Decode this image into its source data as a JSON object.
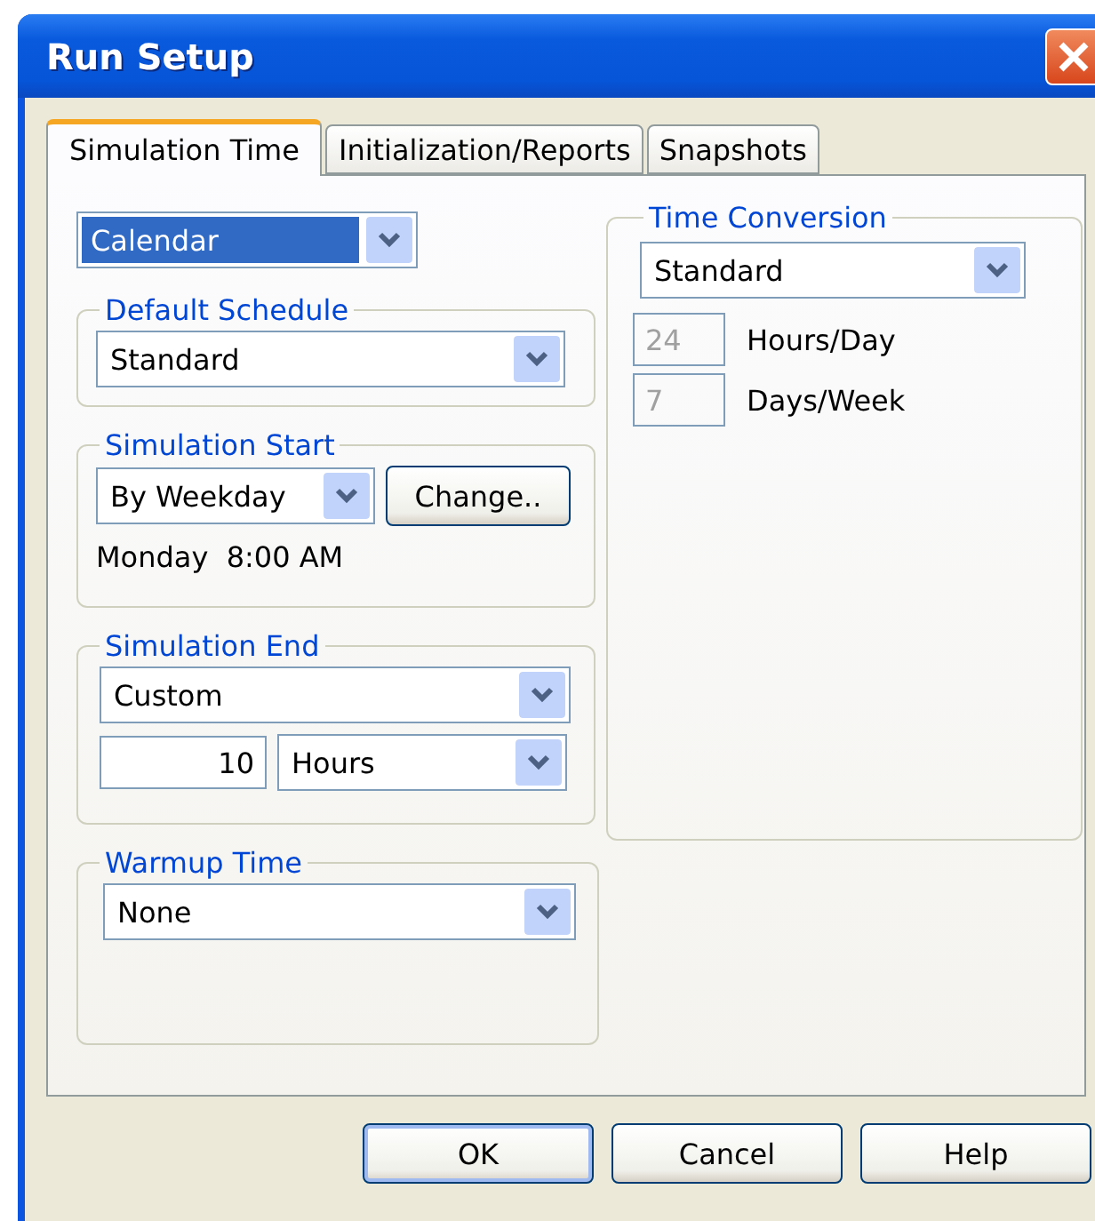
{
  "window": {
    "title": "Run Setup"
  },
  "tabs": [
    {
      "label": "Simulation Time",
      "selected": true
    },
    {
      "label": "Initialization/Reports",
      "selected": false
    },
    {
      "label": "Snapshots",
      "selected": false
    }
  ],
  "mode_select": {
    "value": "Calendar",
    "highlighted": true
  },
  "default_schedule": {
    "title": "Default Schedule",
    "select": "Standard"
  },
  "simulation_start": {
    "title": "Simulation Start",
    "select": "By Weekday",
    "button": "Change..",
    "start_text": "Monday  8:00 AM"
  },
  "simulation_end": {
    "title": "Simulation End",
    "select": "Custom",
    "amount": "10",
    "unit": "Hours"
  },
  "warmup_time": {
    "title": "Warmup Time",
    "select": "None"
  },
  "time_conversion": {
    "title": "Time Conversion",
    "select": "Standard",
    "fields": [
      {
        "value": "24",
        "label": "Hours/Day",
        "disabled": true
      },
      {
        "value": "7",
        "label": "Days/Week",
        "disabled": true
      }
    ]
  },
  "buttons": [
    {
      "label": "OK",
      "default": true
    },
    {
      "label": "Cancel",
      "default": false
    },
    {
      "label": "Help",
      "default": false
    }
  ]
}
